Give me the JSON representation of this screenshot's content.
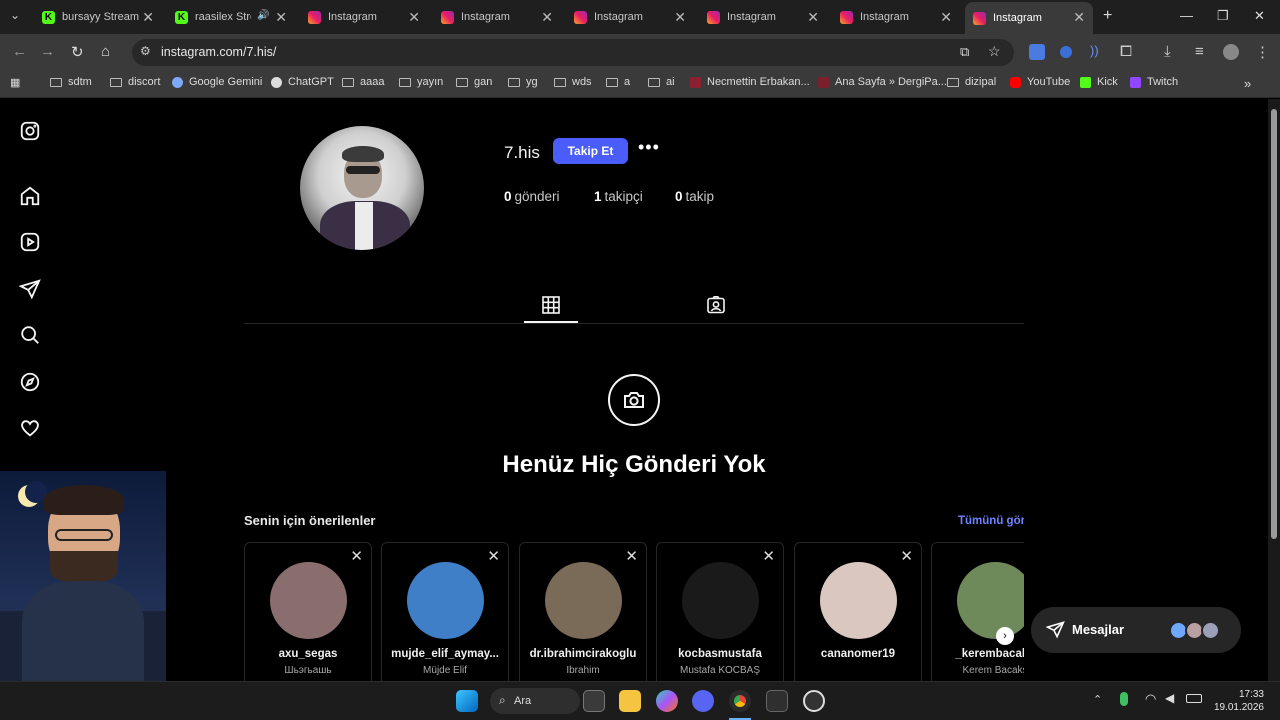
{
  "browser": {
    "tabs": [
      {
        "title": "bursayy Stream",
        "icon": "kick-icon"
      },
      {
        "title": "raasilex Stream",
        "icon": "kick-icon"
      },
      {
        "title": "Instagram",
        "icon": "instagram-icon"
      },
      {
        "title": "Instagram",
        "icon": "instagram-icon"
      },
      {
        "title": "Instagram",
        "icon": "instagram-icon"
      },
      {
        "title": "Instagram",
        "icon": "instagram-icon"
      },
      {
        "title": "Instagram",
        "icon": "instagram-icon"
      },
      {
        "title": "Instagram",
        "icon": "instagram-icon",
        "active": true
      }
    ],
    "url": "instagram.com/7.his/",
    "bookmarks": [
      {
        "label": "sdtm",
        "icon": "folder-icon"
      },
      {
        "label": "discort",
        "icon": "folder-icon"
      },
      {
        "label": "Google Gemini",
        "icon": "gemini-icon"
      },
      {
        "label": "ChatGPT",
        "icon": "chatgpt-icon"
      },
      {
        "label": "aaaa",
        "icon": "folder-icon"
      },
      {
        "label": "yayın",
        "icon": "folder-icon"
      },
      {
        "label": "gan",
        "icon": "folder-icon"
      },
      {
        "label": "yg",
        "icon": "folder-icon"
      },
      {
        "label": "wds",
        "icon": "folder-icon"
      },
      {
        "label": "a",
        "icon": "folder-icon"
      },
      {
        "label": "ai",
        "icon": "folder-icon"
      },
      {
        "label": "Necmettin Erbakan...",
        "icon": "university-icon"
      },
      {
        "label": "Ana Sayfa » DergiPa...",
        "icon": "dergipark-icon"
      },
      {
        "label": "dizipal",
        "icon": "folder-icon"
      },
      {
        "label": "YouTube",
        "icon": "youtube-icon"
      },
      {
        "label": "Kick",
        "icon": "kick-icon"
      },
      {
        "label": "Twitch",
        "icon": "twitch-icon"
      }
    ]
  },
  "profile": {
    "username": "7.his",
    "follow_label": "Takip Et",
    "more_label": "•••",
    "stats": {
      "posts_count": "0",
      "posts_label": "gönderi",
      "followers_count": "1",
      "followers_label": "takipçi",
      "following_count": "0",
      "following_label": "takip"
    }
  },
  "empty_state": {
    "title": "Henüz Hiç Gönderi Yok"
  },
  "suggestions": {
    "title": "Senin için önerilenler",
    "see_all": "Tümünü gör",
    "cards": [
      {
        "username": "axu_segas",
        "subtitle": "Шьэгьашь",
        "color": "#8a6d6d"
      },
      {
        "username": "mujde_elif_aymay...",
        "subtitle": "Müjde Elif",
        "color": "#3f7fc7"
      },
      {
        "username": "dr.ibrahimcirakoglu",
        "subtitle": "İbrahim",
        "color": "#7a6a58"
      },
      {
        "username": "kocbasmustafa",
        "subtitle": "Mustafa KOCBAŞ",
        "color": "#1a1a1a"
      },
      {
        "username": "cananomer19",
        "subtitle": "",
        "color": "#d9c7c0"
      },
      {
        "username": "_kerembacaks",
        "subtitle": "Kerem Bacaks",
        "color": "#6f8a5a"
      }
    ]
  },
  "messages": {
    "label": "Mesajlar"
  },
  "taskbar": {
    "search_label": "Ara",
    "time": "17:33",
    "date": "19.01.2026"
  },
  "colors": {
    "accent_button": "#4a5df9",
    "link_blue": "#6e82ff",
    "page_bg": "#000000"
  }
}
